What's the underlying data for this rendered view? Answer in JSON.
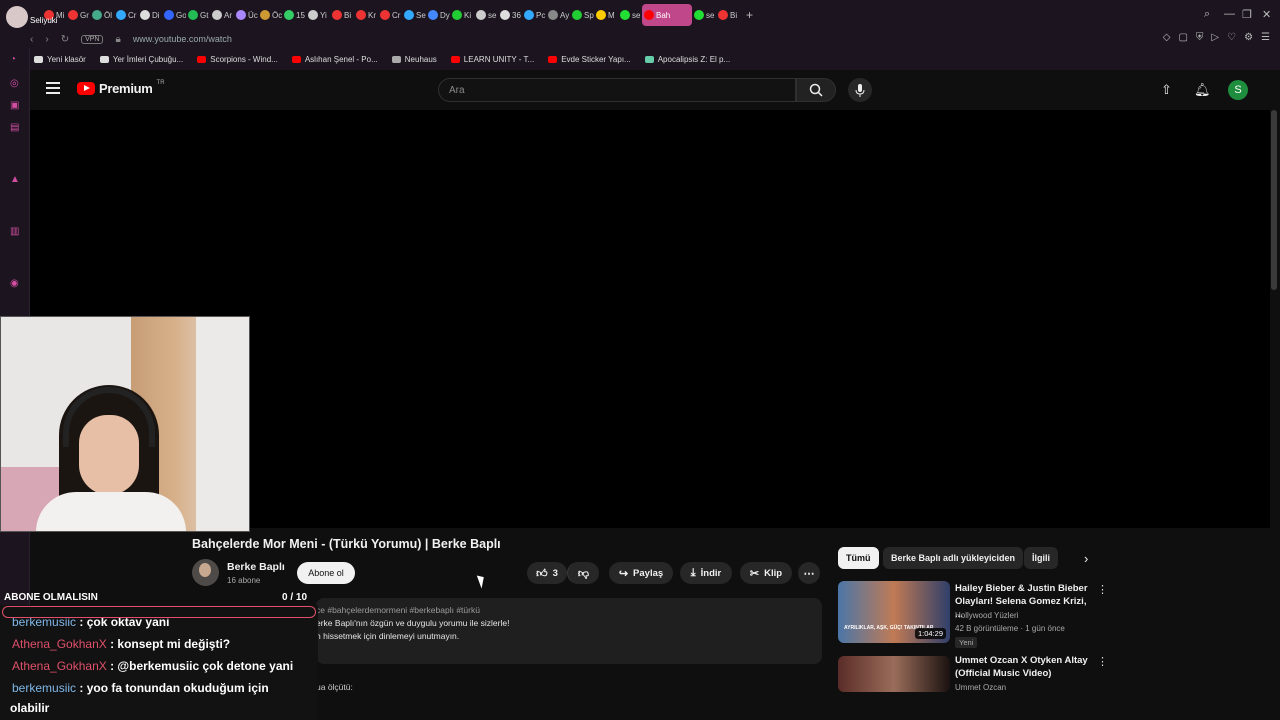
{
  "browser": {
    "profile_label": "Seliyuki",
    "active_tab": "Bah",
    "tabs": [
      "Mi",
      "Gr",
      "Öl",
      "Cr",
      "Di",
      "Go",
      "Gt",
      "Ar",
      "Üc",
      "Öc",
      "15",
      "Yi",
      "Bi",
      "Kr",
      "Cr",
      "Se",
      "Dy",
      "Ki",
      "se",
      "36",
      "Pc",
      "Ay",
      "Sp",
      "M",
      "se",
      "se",
      "Bi"
    ],
    "tab_colors": [
      "#e33",
      "#e33",
      "#4a8",
      "#3af",
      "#ddd",
      "#36f",
      "#2b5",
      "#ccc",
      "#a8f",
      "#c93",
      "#3c6",
      "#ccc",
      "#e33",
      "#e33",
      "#e33",
      "#3af",
      "#48f",
      "#2c3",
      "#ccc",
      "#ddd",
      "#3af",
      "#888",
      "#2c3",
      "#fc0",
      "#2d3",
      "#2d3",
      "#e33"
    ],
    "vpn_label": "VPN",
    "url": "www.youtube.com/watch",
    "bookmarks": [
      {
        "label": "Yeni klasör",
        "color": "#ddd"
      },
      {
        "label": "Yer İmleri Çubuğu...",
        "color": "#ddd"
      },
      {
        "label": "Scorpions - Wind...",
        "color": "#f00"
      },
      {
        "label": "Aslıhan Şenel - Po...",
        "color": "#f00"
      },
      {
        "label": "Neuhaus",
        "color": "#aaa"
      },
      {
        "label": "LEARN UNITY - T...",
        "color": "#f00"
      },
      {
        "label": "Evde Sticker Yapı...",
        "color": "#f00"
      },
      {
        "label": "Apocalipsis Z: El p...",
        "color": "#6ca"
      }
    ]
  },
  "youtube": {
    "logo_text": "Premium",
    "logo_region": "TR",
    "search_placeholder": "Ara",
    "avatar_letter": "S"
  },
  "video": {
    "title": "Bahçelerde Mor Meni - (Türkü Yorumu) | Berke Baplı",
    "channel": "Berke Baplı",
    "subscribers": "16 abone",
    "subscribe_label": "Abone ol",
    "likes": "3",
    "share_label": "Paylaş",
    "download_label": "İndir",
    "clip_label": "Klip",
    "description": {
      "tags": "ce  #bahçelerdemormeni #berkebaplı #türkü",
      "line1": "erke Baplı'nın özgün ve duygulu yorumu ile sizlerle!",
      "line2": "n hissetmek için dinlemeyi unutmayın.",
      "more": "ua ölçütü:"
    }
  },
  "related": {
    "chips": [
      "Tümü",
      "Berke Baplı adlı yükleyiciden",
      "İlgili"
    ],
    "items": [
      {
        "title": "Hailey Bieber & Justin Bieber Olayları! Selena Gomez Krizi, ...",
        "channel": "Hollywood Yüzleri",
        "meta": "42 B görüntüleme · 1 gün önce",
        "badge": "Yeni",
        "duration": "1:04:29",
        "thumb_text": "AYRILIKLAR, AŞK, GÜÇ! TAKINTILAR"
      },
      {
        "title": "Ummet Ozcan X Otyken   Altay (Official Music Video)",
        "channel": "Ummet Ozcan"
      }
    ]
  },
  "chat": {
    "header": "ABONE OLMALISIN",
    "count": "0   / 10",
    "messages": [
      {
        "user": "berkemusiic",
        "color": "blue",
        "text": ": çok oktav yani"
      },
      {
        "user": "Athena_GokhanX",
        "color": "red",
        "text": ": konsept mi değişti?"
      },
      {
        "user": "Athena_GokhanX",
        "color": "red",
        "text": ": @berkemusiic çok detone yani"
      },
      {
        "user": "berkemusiic",
        "color": "blue",
        "text": ": yoo fa tonundan okuduğum için"
      }
    ],
    "continuation": "olabilir"
  }
}
